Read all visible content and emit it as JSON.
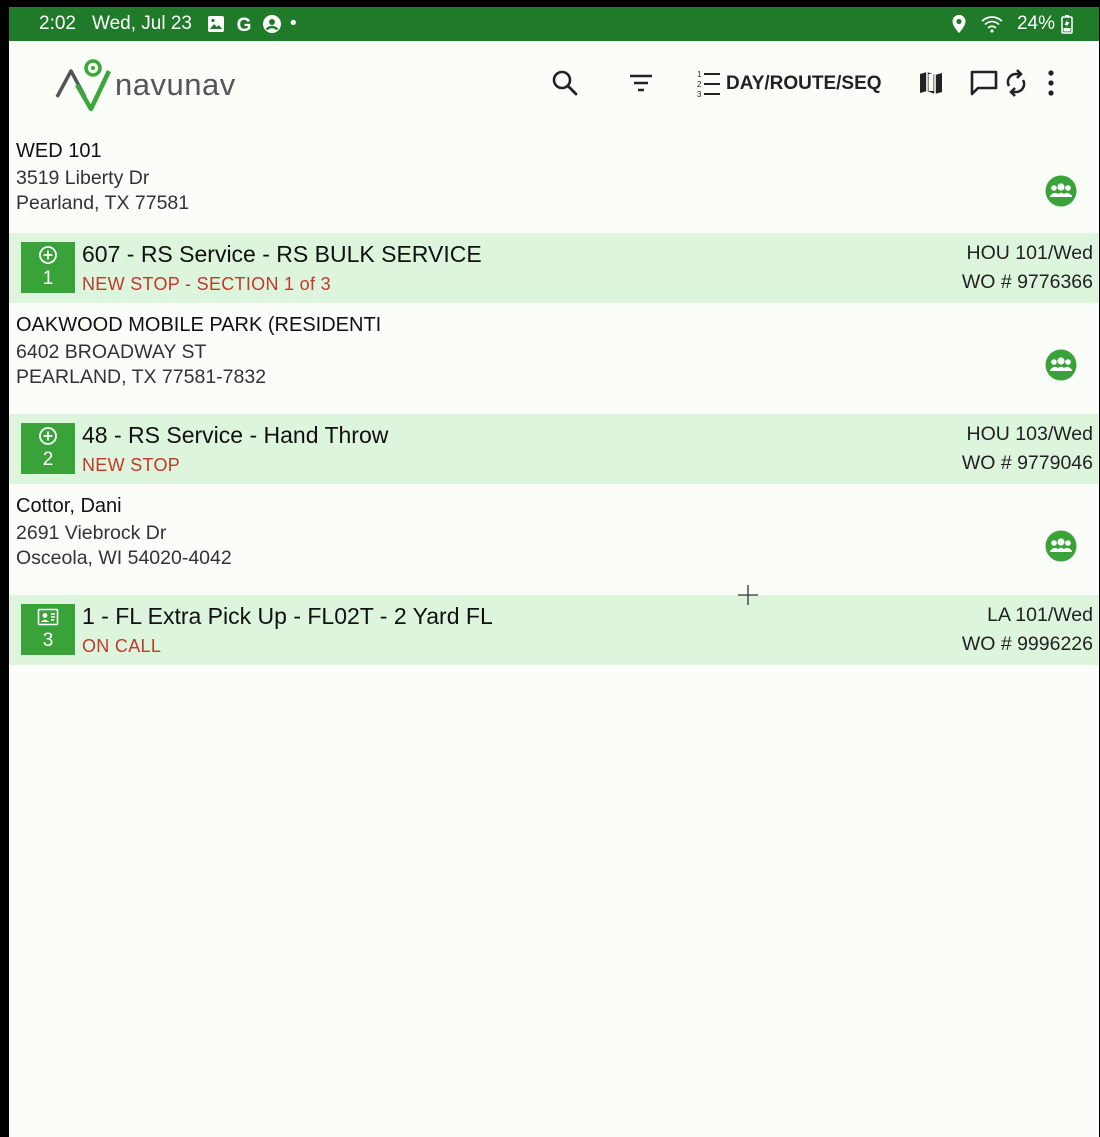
{
  "status_bar": {
    "time": "2:02",
    "date": "Wed, Jul 23",
    "battery": "24%",
    "dot": "•"
  },
  "app": {
    "logo_text": "navunav",
    "sort_label": "DAY/ROUTE/SEQ",
    "accent": "#1f7a2a",
    "badge_color": "#39a339",
    "row_bg": "#ddf5dd",
    "status_color": "#c0392b"
  },
  "stops": [
    {
      "customer_name": "WED 101",
      "address_line1": "3519 Liberty Dr",
      "address_line2": "Pearland, TX 77581",
      "badge_icon": "add-circle-icon",
      "seq": "1",
      "title": "607 - RS Service - RS BULK SERVICE",
      "status": "NEW STOP - SECTION 1 of 3",
      "route": "HOU 101/Wed",
      "wo": "WO # 9776366"
    },
    {
      "customer_name": "OAKWOOD MOBILE PARK (RESIDENTI",
      "address_line1": "6402 BROADWAY ST",
      "address_line2": "PEARLAND, TX 77581-7832",
      "badge_icon": "add-circle-icon",
      "seq": "2",
      "title": "48 - RS Service - Hand Throw",
      "status": "NEW STOP",
      "route": "HOU 103/Wed",
      "wo": "WO # 9779046"
    },
    {
      "customer_name": "Cottor, Dani",
      "address_line1": "2691 Viebrock Dr",
      "address_line2": "Osceola, WI 54020-4042",
      "badge_icon": "contact-card-icon",
      "seq": "3",
      "title": "1 - FL Extra Pick Up - FL02T - 2 Yard FL",
      "status": "ON CALL",
      "route": "LA 101/Wed",
      "wo": "WO # 9996226"
    }
  ]
}
